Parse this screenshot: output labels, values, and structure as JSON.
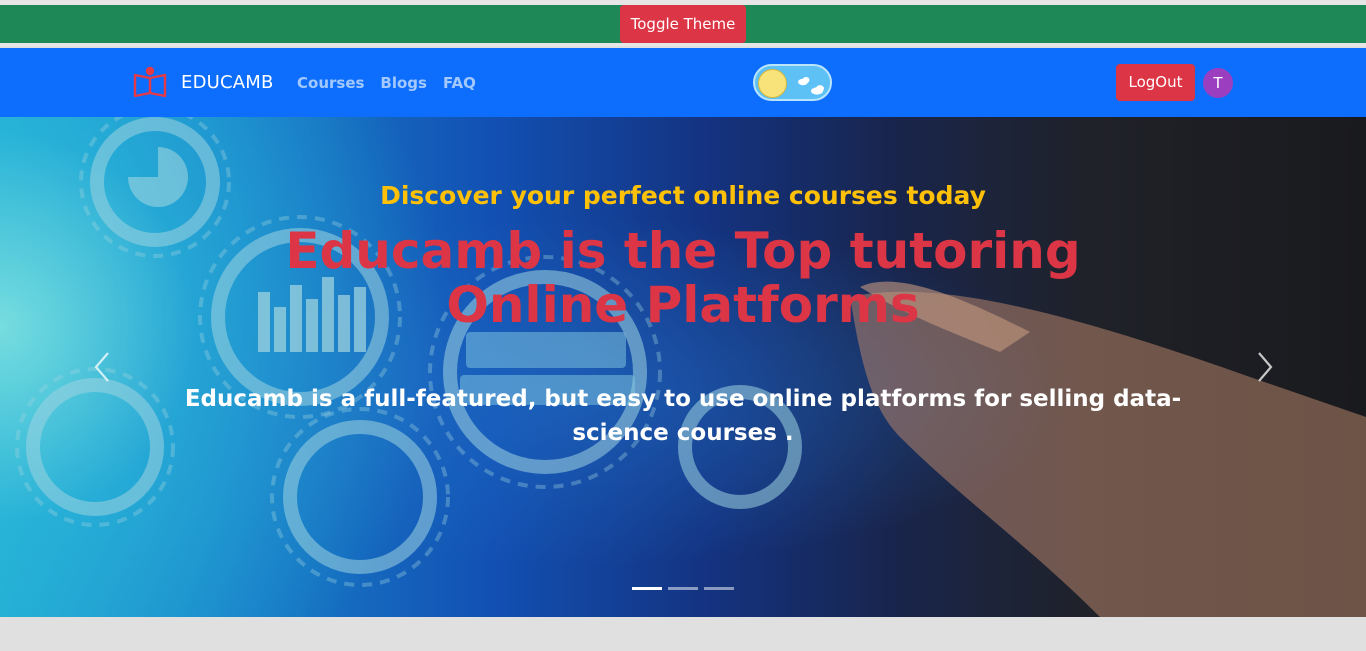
{
  "toolbar": {
    "toggle_theme_label": "Toggle Theme"
  },
  "navbar": {
    "brand": "EDUCAMB",
    "brand_icon": "open-book-icon",
    "links": [
      "Courses",
      "Blogs",
      "FAQ"
    ],
    "theme_switch_icon": "sun-cloud-icon",
    "logout_label": "LogOut",
    "avatar_initial": "T"
  },
  "hero": {
    "eyebrow": "Discover your perfect online courses today",
    "headline": "Educamb is the Top tutoring Online Platforms",
    "lead": "Educamb is a full-featured, but easy to use online platforms for selling data-science courses .",
    "slide_count": 3,
    "active_slide": 1
  },
  "colors": {
    "green_bar": "#1e8856",
    "navbar": "#0d6efd",
    "danger": "#dc3545",
    "warning": "#ffc107",
    "avatar": "#9b3fc0"
  }
}
